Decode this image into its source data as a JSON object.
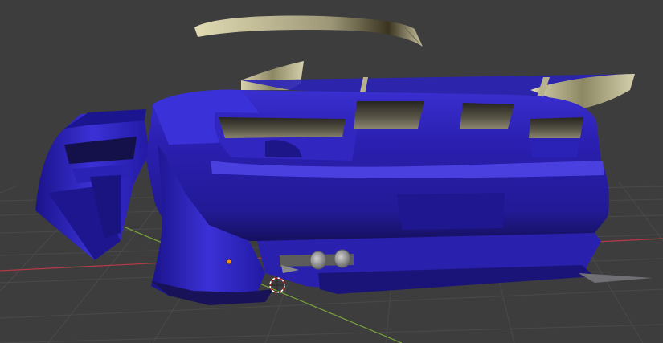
{
  "editor": {
    "type": "3D Viewport",
    "shading": "material-preview",
    "background_color": "#3d3d3d",
    "grid_color": "#4a4a4a",
    "x_axis_color": "#b03a45",
    "y_axis_color": "#7aa33a"
  },
  "scene": {
    "objects": [
      {
        "name": "car-body",
        "material_color": "#2a1fa8"
      },
      {
        "name": "rear-wing",
        "material_color": "#cfc9a6"
      },
      {
        "name": "floating-spoiler-blade",
        "material_color": "#cfc9a6"
      },
      {
        "name": "exhaust-tips",
        "material_color": "#9a9a9a"
      }
    ]
  },
  "overlays": {
    "cursor_3d": "3d-cursor-icon",
    "origin_point": "object-origin-icon"
  }
}
